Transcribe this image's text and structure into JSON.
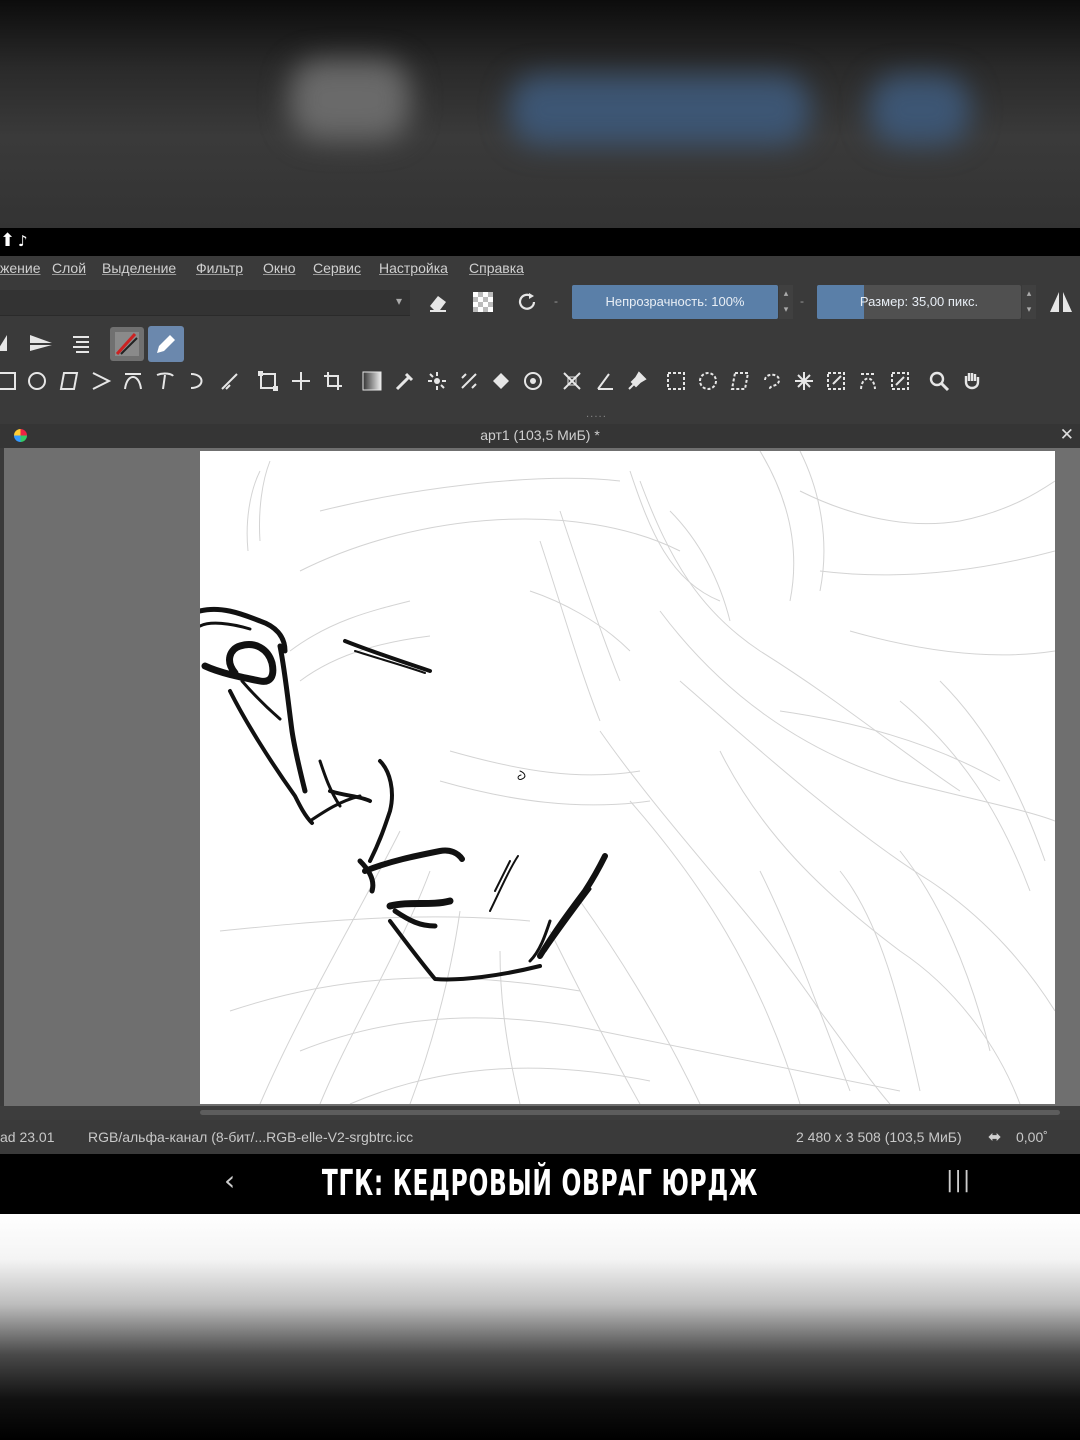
{
  "menu": {
    "items": [
      "жение",
      "Слой",
      "Выделение",
      "Фильтр",
      "Окно",
      "Сервис",
      "Настройка",
      "Справка"
    ]
  },
  "options": {
    "opacity_label": "Непрозрачность: 100%",
    "opacity_value": 1.0,
    "size_label": "Размер: 35,00 пикс.",
    "size_fill_fraction": 0.23
  },
  "document": {
    "tab_title": "арт1 (103,5 МиБ)  *"
  },
  "status": {
    "brush": "ad 23.01",
    "color_profile": "RGB/альфа-канал (8-бит/...RGB-elle-V2-srgbtrc.icc",
    "dimensions": "2 480 x 3 508 (103,5 МиБ)",
    "rotation": "0,00˚"
  },
  "overlay": {
    "caption": "ТГК: КЕДРОВЫЙ ОВРАГ ЮРДЖ"
  },
  "icons": {
    "toolbar_row1": [
      "mirror-h-icon",
      "mirror-v-icon",
      "wrap-around-icon",
      "brush-presets-icon",
      "freehand-brush-icon"
    ],
    "toolbar_row2": [
      "rectangle-icon",
      "ellipse-icon",
      "polygon-icon",
      "polyline-icon",
      "bezier-icon",
      "freehand-path-icon",
      "dynamic-brush-icon",
      "multibrush-icon",
      "transform-icon",
      "move-icon",
      "crop-icon",
      "gradient-icon",
      "color-picker-icon",
      "smart-patch-icon",
      "fill-icon",
      "enclose-fill-icon",
      "assistant-icon",
      "measure-icon",
      "reference-icon",
      "rect-select-icon",
      "ellipse-select-icon",
      "polygon-select-icon",
      "freehand-select-icon",
      "contiguous-select-icon",
      "similar-select-icon",
      "bezier-select-icon",
      "magnetic-select-icon",
      "zoom-icon",
      "pan-icon"
    ]
  }
}
